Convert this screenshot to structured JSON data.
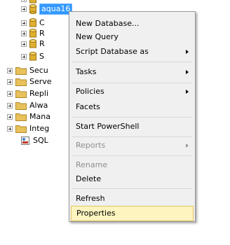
{
  "tree": {
    "selected_db": "aqua16",
    "db_items": [
      "C",
      "R",
      "R",
      "S"
    ],
    "folders": [
      "Secu",
      "Serve",
      "Repli",
      "Alwa",
      "Mana",
      "Integ"
    ],
    "sql_item": "SQL"
  },
  "context_menu": {
    "new_database": "New Database...",
    "new_query": "New Query",
    "script_database_as": "Script Database as",
    "tasks": "Tasks",
    "policies": "Policies",
    "facets": "Facets",
    "start_powershell": "Start PowerShell",
    "reports": "Reports",
    "rename": "Rename",
    "delete": "Delete",
    "refresh": "Refresh",
    "properties": "Properties"
  },
  "colors": {
    "selection": "#3399ff",
    "menu_background": "#f0f0f0",
    "hover_background": "#fdf4bf",
    "hover_border": "#e5c365",
    "folder": "#e8c15a",
    "database": "#e0b030"
  },
  "icons": {
    "database": "database-icon",
    "folder": "folder-icon",
    "sql_agent": "sql-agent-icon",
    "submenu": "submenu-arrow-icon"
  }
}
